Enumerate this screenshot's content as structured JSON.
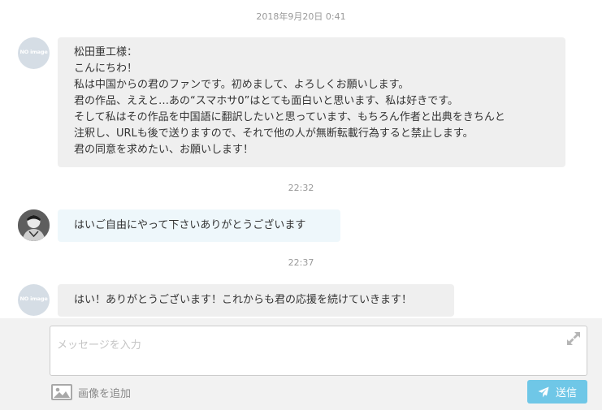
{
  "thread": {
    "messages": [
      {
        "timestamp": "2018年9月20日 0:41",
        "sender_avatar": "noimage-avatar",
        "avatar_text": "NO image",
        "lines": [
          "松田重工様：",
          "こんにちわ！",
          "私は中国からの君のファンです。初めまして、よろしくお願いします。",
          "君の作品、ええと…あの“スマホサ0”はとても面白いと思います、私は好きです。",
          "そして私はその作品を中国語に翻訳したいと思っています、もちろん作者と出典をきちんと",
          "注釈し、URLも後で送りますので、それで他の人が無断転載行為すると禁止します。",
          "君の同意を求めたい、お願いします！"
        ]
      },
      {
        "timestamp": "22:32",
        "sender_avatar": "user-photo-avatar",
        "lines": [
          "はいご自由にやって下さいありがとうございます"
        ]
      },
      {
        "timestamp": "22:37",
        "sender_avatar": "noimage-avatar",
        "avatar_text": "NO image",
        "lines": [
          "はい！ありがとうございます！これからも君の応援を続けていきます！"
        ]
      }
    ]
  },
  "composer": {
    "placeholder": "メッセージを入力",
    "value": "",
    "expand_icon": "expand-arrows-icon",
    "add_image_label": "画像を追加",
    "add_image_icon": "image-icon",
    "send_label": "送信",
    "send_icon": "paper-plane-icon"
  },
  "colors": {
    "send_button": "#6fc7e7",
    "bubble_gray": "#efefef",
    "bubble_blue": "#eef7fb",
    "composer_bg": "#f2f2f2",
    "timestamp": "#999999"
  }
}
